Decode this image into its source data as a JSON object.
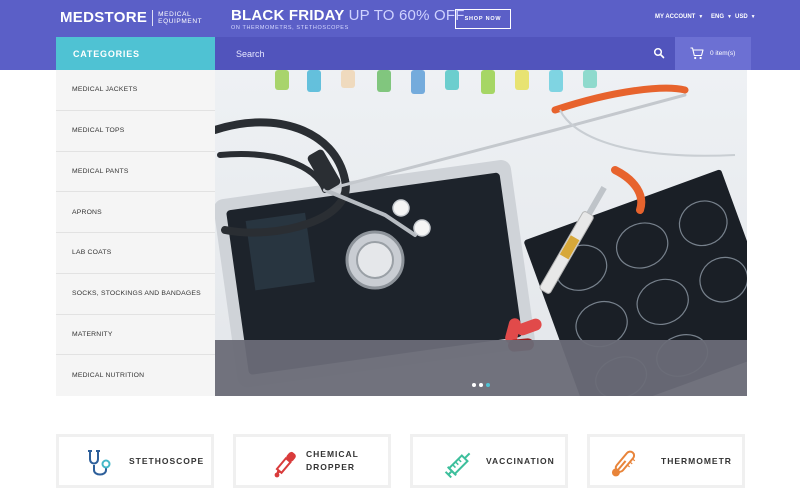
{
  "header": {
    "logo_main": "MEDSTORE",
    "logo_sub_line1": "MEDICAL",
    "logo_sub_line2": "EQUIPMENT",
    "promo_title": "BLACK FRIDAY",
    "promo_offer": "UP TO 60% OFF",
    "promo_sub": "ON THERMOMETRS, STETHOSCOPES",
    "shop_button": "SHOP NOW",
    "account_label": "MY ACCOUNT",
    "language_label": "ENG",
    "currency_label": "USD"
  },
  "nav": {
    "categories_label": "CATEGORIES",
    "search_placeholder": "Search",
    "cart_label": "0 item(s)"
  },
  "sidebar": {
    "items": [
      {
        "label": "MEDICAL JACKETS"
      },
      {
        "label": "MEDICAL TOPS"
      },
      {
        "label": "MEDICAL PANTS"
      },
      {
        "label": "APRONS"
      },
      {
        "label": "LAB COATS"
      },
      {
        "label": "SOCKS, STOCKINGS AND BANDAGES"
      },
      {
        "label": "MATERNITY"
      },
      {
        "label": "MEDICAL NUTRITION"
      }
    ]
  },
  "hero": {
    "slide_count": 3,
    "active_slide": 3
  },
  "features": [
    {
      "label": "STETHOSCOPE",
      "icon": "stethoscope-icon"
    },
    {
      "label_line1": "CHEMICAL",
      "label_line2": "DROPPER",
      "icon": "dropper-icon"
    },
    {
      "label": "VACCINATION",
      "icon": "syringe-icon"
    },
    {
      "label": "THERMOMETR",
      "icon": "thermometer-icon"
    }
  ],
  "colors": {
    "header_bg": "#5b5fc7",
    "categories_bg": "#4fc2d3",
    "search_bg": "#5154bc",
    "cart_bg": "#6c70d3"
  }
}
